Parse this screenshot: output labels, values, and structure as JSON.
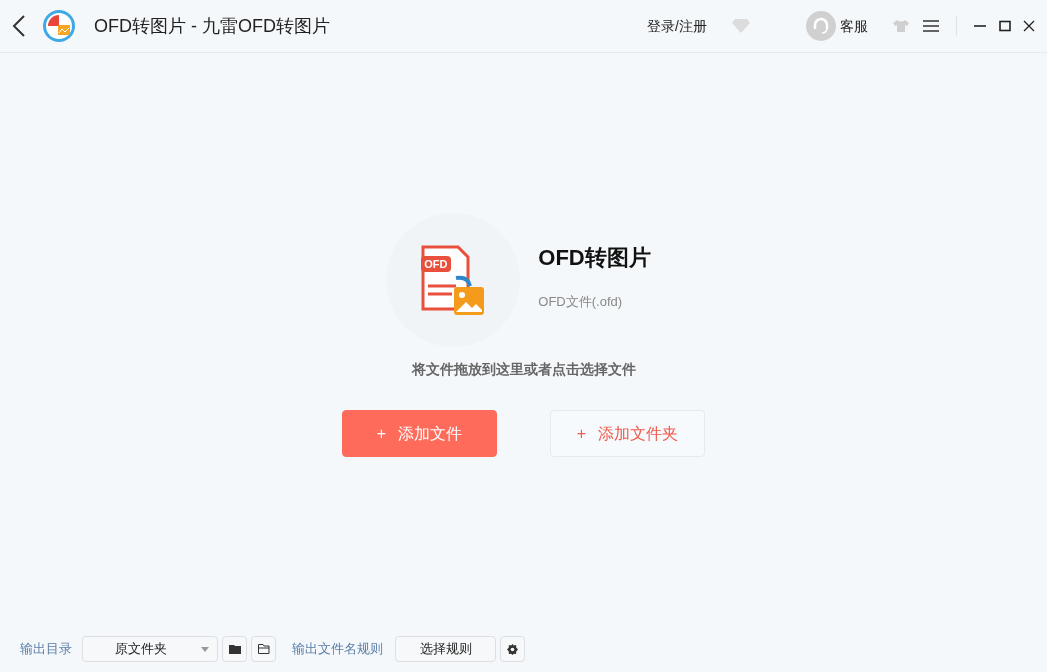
{
  "window": {
    "title": "OFD转图片 - 九雷OFD转图片"
  },
  "header": {
    "login": "登录/注册",
    "support": "客服"
  },
  "hero": {
    "icon_tag": "OFD",
    "title": "OFD转图片",
    "subtitle": "OFD文件(.ofd)",
    "hint": "将文件拖放到这里或者点击选择文件"
  },
  "buttons": [
    {
      "label": "添加文件",
      "kind": "primary",
      "icon": "+"
    },
    {
      "label": "添加文件夹",
      "kind": "secondary",
      "icon": "+"
    }
  ],
  "footer": {
    "output_label": "输出目录",
    "output_value": "原文件夹",
    "rule_label": "输出文件名规则",
    "rule_button": "选择规则"
  }
}
